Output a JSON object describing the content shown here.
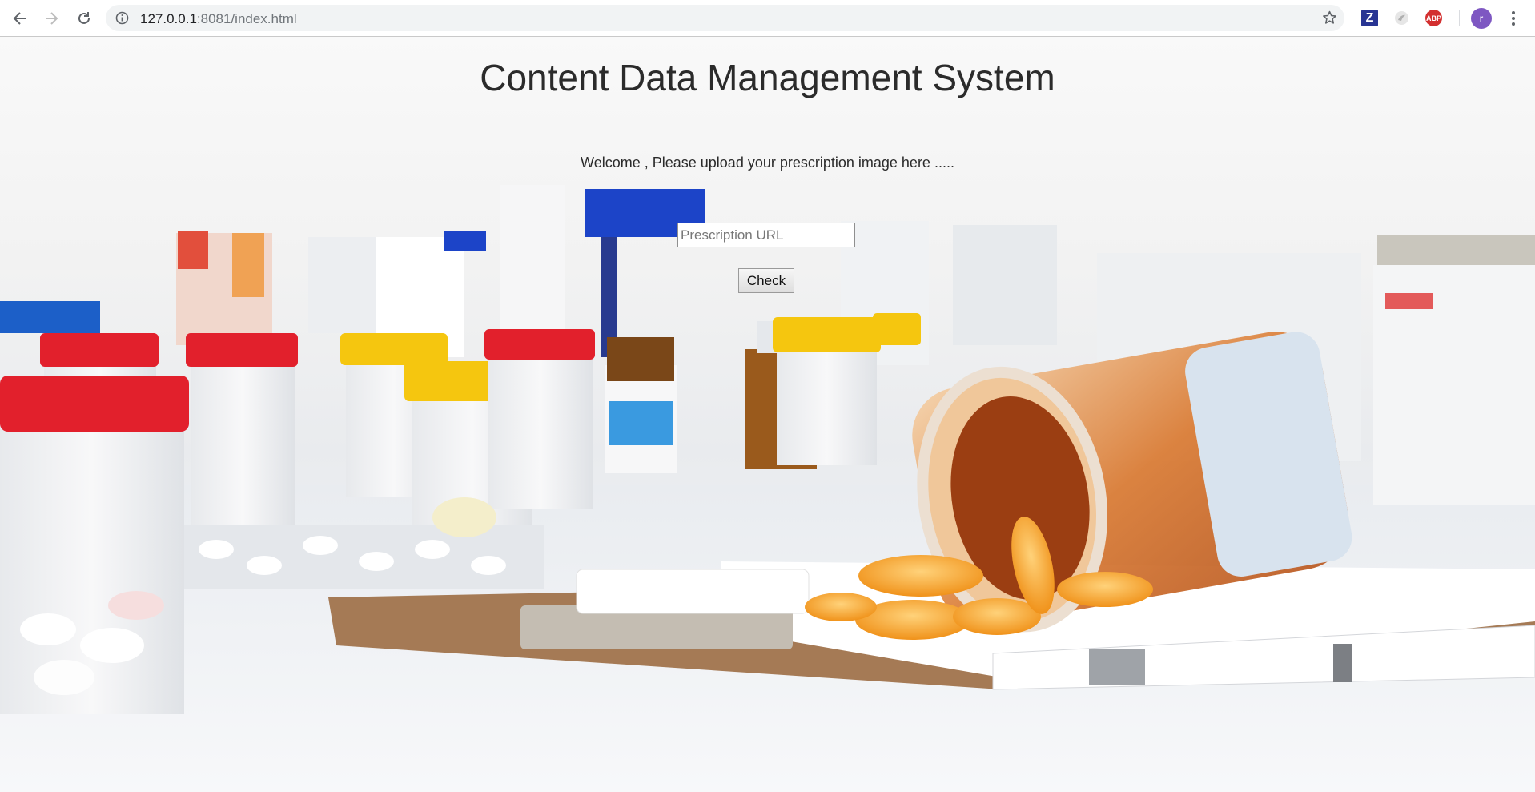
{
  "browser": {
    "url_host": "127.0.0.1",
    "url_path": ":8081/index.html",
    "profile_initial": "r",
    "extensions": {
      "zotero": "Z",
      "adblock": "ABP"
    }
  },
  "page": {
    "title": "Content Data Management System",
    "welcome_text": "Welcome , Please upload your prescription image here .....",
    "url_input_placeholder": "Prescription URL",
    "check_button_label": "Check"
  },
  "colors": {
    "cap_red": "#e2202c",
    "cap_yellow": "#f5c60f",
    "cap_blue": "#1c44c8",
    "capsule_orange": "#f39b1e"
  }
}
